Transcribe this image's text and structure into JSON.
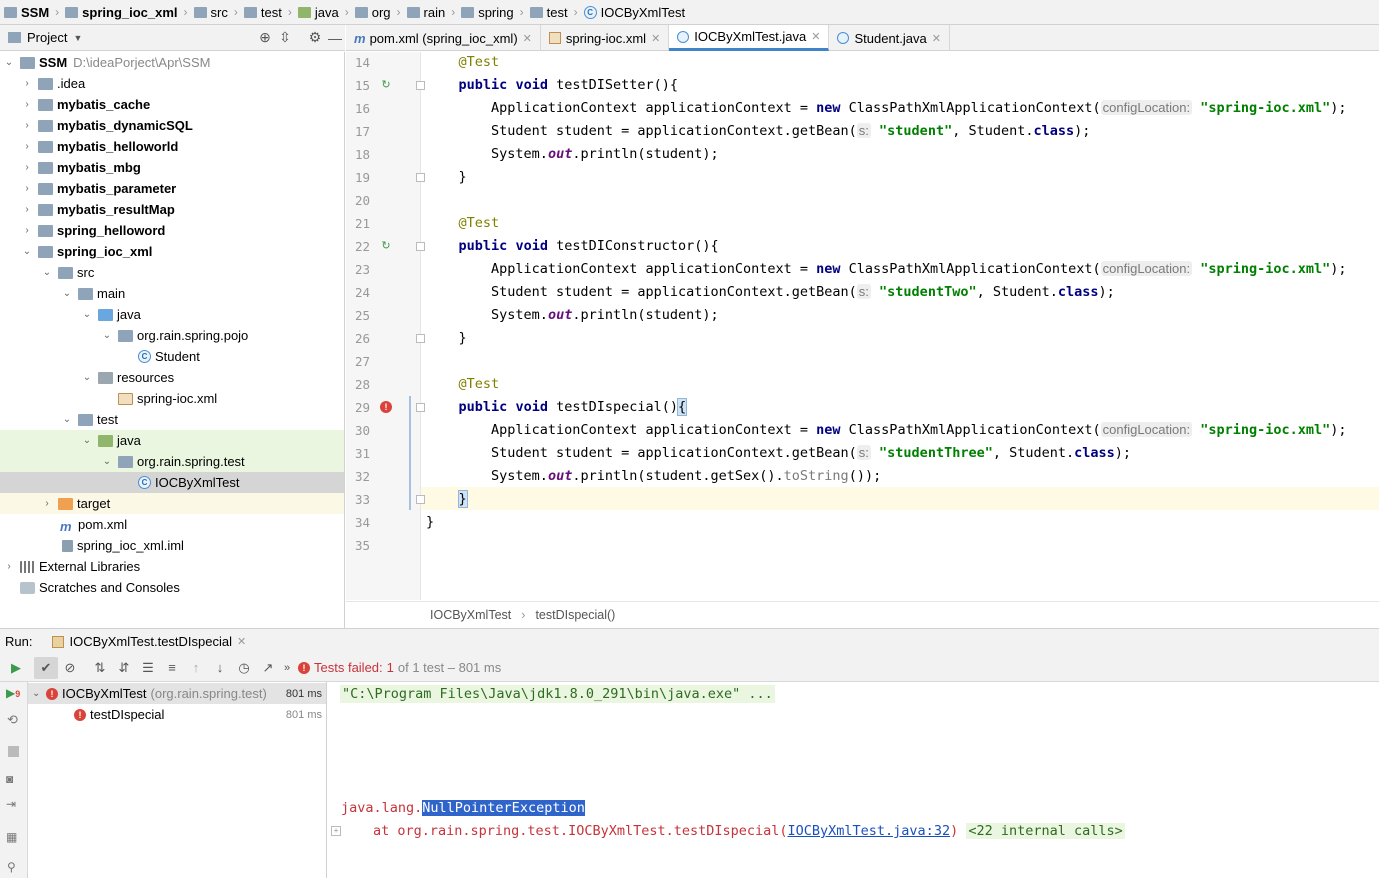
{
  "breadcrumbs": [
    "SSM",
    "spring_ioc_xml",
    "src",
    "test",
    "java",
    "org",
    "rain",
    "spring",
    "test",
    "IOCByXmlTest"
  ],
  "project_panel": {
    "title": "Project"
  },
  "tree": [
    {
      "label": "SSM",
      "extra": "D:\\ideaPorject\\Apr\\SSM"
    },
    {
      "label": ".idea"
    },
    {
      "label": "mybatis_cache"
    },
    {
      "label": "mybatis_dynamicSQL"
    },
    {
      "label": "mybatis_helloworld"
    },
    {
      "label": "mybatis_mbg"
    },
    {
      "label": "mybatis_parameter"
    },
    {
      "label": "mybatis_resultMap"
    },
    {
      "label": "spring_helloword"
    },
    {
      "label": "spring_ioc_xml"
    },
    {
      "label": "src"
    },
    {
      "label": "main"
    },
    {
      "label": "java"
    },
    {
      "label": "org.rain.spring.pojo"
    },
    {
      "label": "Student"
    },
    {
      "label": "resources"
    },
    {
      "label": "spring-ioc.xml"
    },
    {
      "label": "test"
    },
    {
      "label": "java"
    },
    {
      "label": "org.rain.spring.test"
    },
    {
      "label": "IOCByXmlTest"
    },
    {
      "label": "target"
    },
    {
      "label": "pom.xml"
    },
    {
      "label": "spring_ioc_xml.iml"
    },
    {
      "label": "External Libraries"
    },
    {
      "label": "Scratches and Consoles"
    }
  ],
  "tabs": [
    {
      "label": "pom.xml (spring_ioc_xml)"
    },
    {
      "label": "spring-ioc.xml"
    },
    {
      "label": "IOCByXmlTest.java"
    },
    {
      "label": "Student.java"
    }
  ],
  "code": {
    "line_numbers": [
      "14",
      "15",
      "16",
      "17",
      "18",
      "19",
      "20",
      "21",
      "22",
      "23",
      "24",
      "25",
      "26",
      "27",
      "28",
      "29",
      "30",
      "31",
      "32",
      "33",
      "34",
      "35"
    ],
    "annotation": "@Test",
    "kw_public": "public",
    "kw_void": "void",
    "kw_new": "new",
    "kw_class": "class",
    "method1": "testDISetter(){",
    "method2": "testDIConstructor(){",
    "method3": "testDIspecial()",
    "brace_open": "{",
    "brace_close": "}",
    "ctx_decl": "ApplicationContext applicationContext = ",
    "ctx_new": "ClassPathXmlApplicationContext(",
    "hint_config": "configLocation:",
    "xml_str": "\"spring-ioc.xml\"",
    "close_stmt": ");",
    "student_decl": "Student student = applicationContext.getBean(",
    "hint_s": "s:",
    "str_student": "\"student\"",
    "str_studentTwo": "\"studentTwo\"",
    "str_studentThree": "\"studentThree\"",
    "student_class": ", Student.",
    "sys": "System.",
    "out": "out",
    "println1": ".println(student);",
    "println3a": ".println(student.getSex().",
    "tostring": "toString",
    "println3b": "());",
    "class_close": "}"
  },
  "editor_breadcrumb": [
    "IOCByXmlTest",
    "testDIspecial()"
  ],
  "run": {
    "label": "Run:",
    "tab": "IOCByXmlTest.testDIspecial",
    "status_failed": "Tests failed:",
    "status_count": "1",
    "status_rest": "of 1 test – 801 ms",
    "tests": [
      {
        "name": "IOCByXmlTest",
        "pkg": "(org.rain.spring.test)",
        "time": "801 ms"
      },
      {
        "name": "testDIspecial",
        "time": "801 ms"
      }
    ],
    "console": {
      "cmd": "\"C:\\Program Files\\Java\\jdk1.8.0_291\\bin\\java.exe\" ...",
      "exc_prefix": "java.lang.",
      "exc_name": "NullPointerException",
      "at_line": "at org.rain.spring.test.IOCByXmlTest.testDIspecial(",
      "link": "IOCByXmlTest.java:32",
      "at_close": ")",
      "internal": "<22 internal calls>"
    }
  },
  "colors": {
    "accent": "#4083c9",
    "error": "#d9433a",
    "selection": "#d5d5d5",
    "highlight": "#eaf6e0"
  }
}
